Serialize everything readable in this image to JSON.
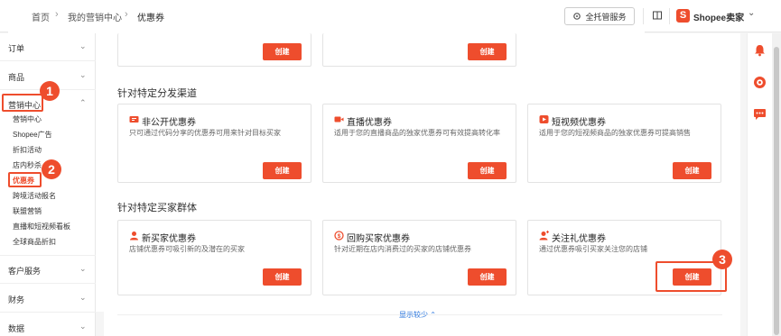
{
  "topbar": {
    "breadcrumb": [
      "首页",
      "我的营销中心",
      "优惠券"
    ],
    "managed_service": "全托管服务",
    "seller_label": "Shopee卖家",
    "logo_letter": "S"
  },
  "sidebar": {
    "groups": [
      {
        "label": "订单"
      },
      {
        "label": "商品"
      },
      {
        "label": "营销中心"
      },
      {
        "label": "客户服务"
      },
      {
        "label": "财务"
      },
      {
        "label": "数据"
      }
    ],
    "marketing_items": [
      "营销中心",
      "Shopee广告",
      "折扣活动",
      "店内秒杀",
      "优惠券",
      "跨境活动报名",
      "联盟营销",
      "直播和短视频看板",
      "全球商品折扣"
    ]
  },
  "sections": {
    "channel_title": "针对特定分发渠道",
    "buyer_title": "针对特定买家群体"
  },
  "create_label": "创建",
  "channel_cards": [
    {
      "title": "非公开优惠券",
      "desc": "只可通过代码分享的优惠券可用来针对目标买家",
      "icon": "ticket-icon"
    },
    {
      "title": "直播优惠券",
      "desc": "适用于您的直播商品的独家优惠券可有效提高转化率",
      "icon": "live-camera-icon"
    },
    {
      "title": "短视频优惠券",
      "desc": "适用于您的短视频商品的独家优惠券可提高销售",
      "icon": "video-play-icon"
    }
  ],
  "buyer_cards": [
    {
      "title": "新买家优惠券",
      "desc": "店铺优惠券可吸引新的及潜在的买家",
      "icon": "new-user-icon"
    },
    {
      "title": "回购买家优惠券",
      "desc": "针对近期在店内消费过的买家的店铺优惠券",
      "icon": "repeat-buyer-icon"
    },
    {
      "title": "关注礼优惠券",
      "desc": "通过优惠券吸引买家关注您的店铺",
      "icon": "follow-user-icon"
    }
  ],
  "show_less": "显示较少",
  "annotations": [
    "1",
    "2",
    "3"
  ],
  "colors": {
    "accent": "#ee4d2d",
    "link": "#2673dd"
  }
}
